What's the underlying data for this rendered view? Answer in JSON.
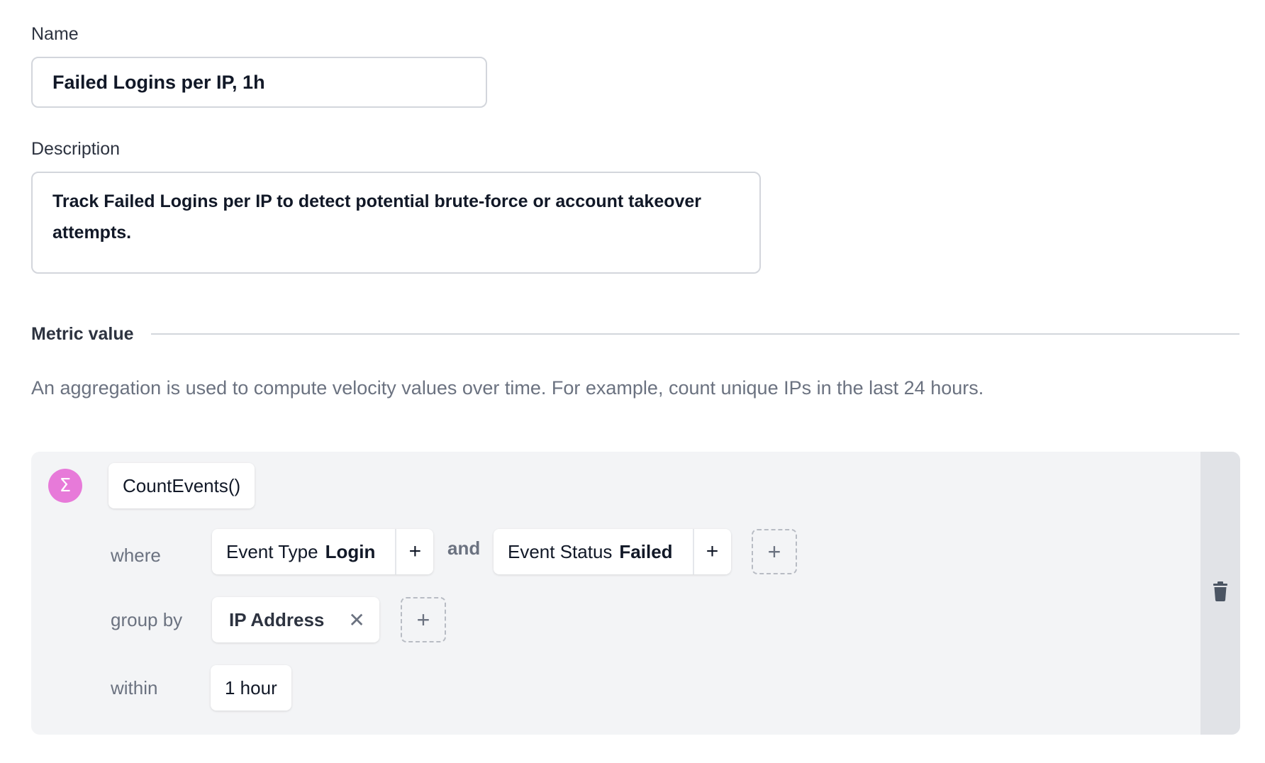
{
  "name_field": {
    "label": "Name",
    "value": "Failed Logins per IP, 1h"
  },
  "description_field": {
    "label": "Description",
    "value": "Track Failed Logins per IP to detect potential brute-force or account takeover attempts."
  },
  "metric_section": {
    "title": "Metric value",
    "help_text": "An aggregation is used to compute velocity values over time. For example, count unique IPs in the last 24 hours."
  },
  "metric": {
    "badge_symbol": "Σ",
    "aggregation": "CountEvents()",
    "where_label": "where",
    "conditions": [
      {
        "field": "Event Type",
        "value": "Login",
        "add_symbol": "+"
      },
      {
        "field": "Event Status",
        "value": "Failed",
        "add_symbol": "+"
      }
    ],
    "and_label": "and",
    "add_condition_symbol": "+",
    "group_by_label": "group by",
    "group_by": {
      "value": "IP Address",
      "remove_symbol": "✕"
    },
    "add_group_symbol": "+",
    "within_label": "within",
    "within_value": "1 hour",
    "delete_icon": "trash-icon"
  },
  "colors": {
    "sigma_badge": "#e77ad9",
    "panel_bg": "#f3f4f6",
    "panel_side": "#e1e3e7",
    "muted_text": "#6b7280"
  }
}
